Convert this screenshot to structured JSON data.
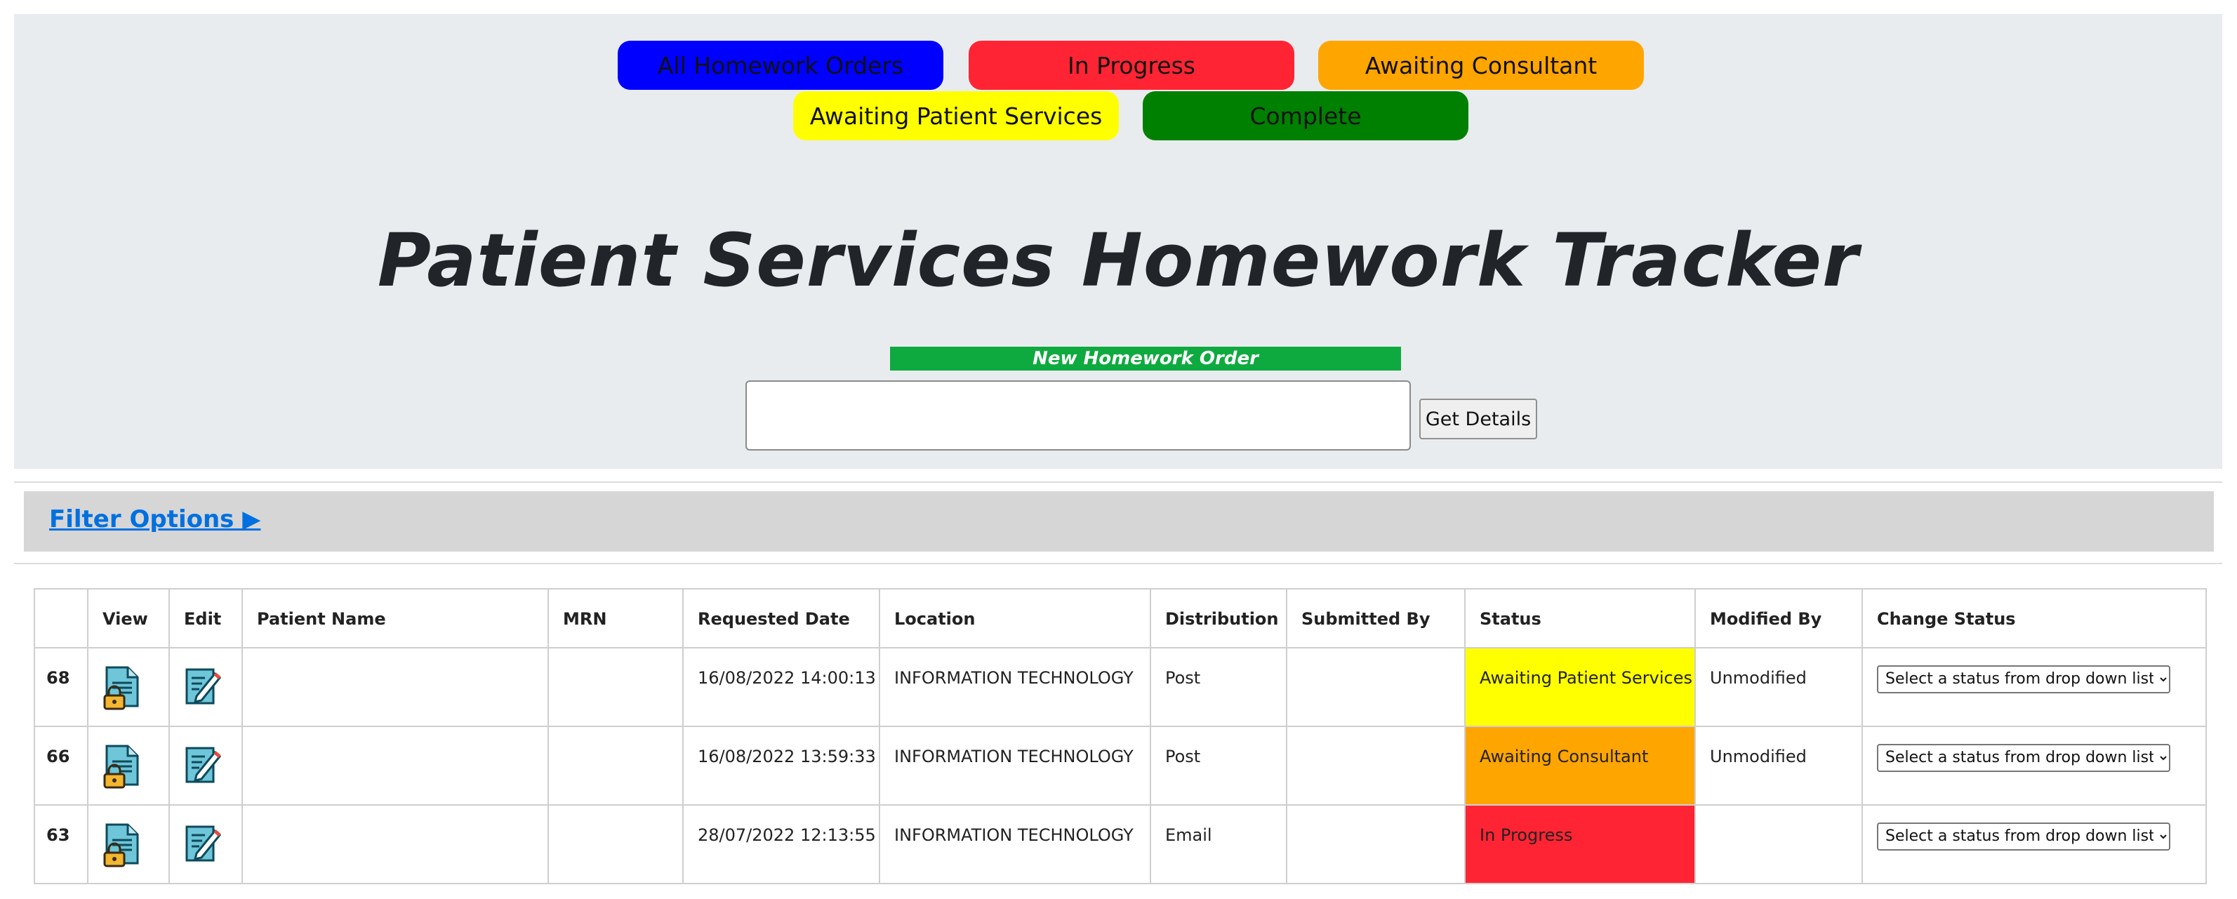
{
  "status_buttons": [
    {
      "label": "All Homework Orders",
      "color": "#0000ff"
    },
    {
      "label": "In Progress",
      "color": "#ff2433"
    },
    {
      "label": "Awaiting Consultant",
      "color": "#ffa500"
    },
    {
      "label": "Awaiting Patient Services",
      "color": "#ffff00"
    },
    {
      "label": "Complete",
      "color": "#008000"
    }
  ],
  "title": "Patient Services Homework Tracker",
  "new_order": {
    "label": "New Homework Order",
    "input_value": "",
    "button_label": "Get Details"
  },
  "filter": {
    "label": "Filter Options ▶"
  },
  "table": {
    "headers": [
      "",
      "View",
      "Edit",
      "Patient Name",
      "MRN",
      "Requested Date",
      "Location",
      "Distribution",
      "Submitted By",
      "Status",
      "Modified By",
      "Change Status"
    ],
    "rows": [
      {
        "id": "68",
        "patient_name": "",
        "mrn": "",
        "requested_date": "16/08/2022 14:00:13",
        "location": "INFORMATION TECHNOLOGY",
        "distribution": "Post",
        "submitted_by": "",
        "status": "Awaiting Patient Services",
        "status_color": "#ffff00",
        "modified_by": "Unmodified",
        "change_status": "Select a status from drop down list"
      },
      {
        "id": "66",
        "patient_name": "",
        "mrn": "",
        "requested_date": "16/08/2022 13:59:33",
        "location": "INFORMATION TECHNOLOGY",
        "distribution": "Post",
        "submitted_by": "",
        "status": "Awaiting Consultant",
        "status_color": "#ffa500",
        "modified_by": "Unmodified",
        "change_status": "Select a status from drop down list"
      },
      {
        "id": "63",
        "patient_name": "",
        "mrn": "",
        "requested_date": "28/07/2022 12:13:55",
        "location": "INFORMATION TECHNOLOGY",
        "distribution": "Email",
        "submitted_by": "",
        "status": "In Progress",
        "status_color": "#ff2433",
        "modified_by": "",
        "change_status": "Select a status from drop down list"
      }
    ]
  },
  "icons": {
    "view": "locked-document-icon",
    "edit": "edit-document-icon"
  }
}
